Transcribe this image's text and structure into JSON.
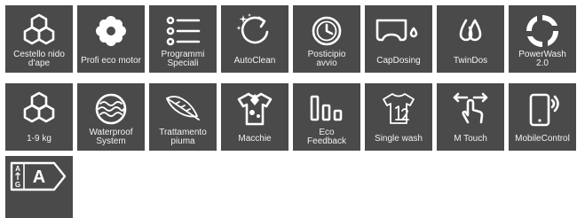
{
  "tiles": [
    {
      "label": "Cestello nido\nd'ape",
      "icon": "honeycomb-drum-icon"
    },
    {
      "label": "Profi eco motor",
      "icon": "flower-gear-icon"
    },
    {
      "label": "Programmi\nSpeciali",
      "icon": "list-icon"
    },
    {
      "label": "AutoClean",
      "icon": "sparkle-refresh-icon"
    },
    {
      "label": "Posticipio\navvio",
      "icon": "clock-icon"
    },
    {
      "label": "CapDosing",
      "icon": "capsule-drop-icon"
    },
    {
      "label": "TwinDos",
      "icon": "twin-drops-icon"
    },
    {
      "label": "PowerWash\n2.0",
      "icon": "spin-arrows-icon"
    },
    {
      "label": "1-9 kg",
      "icon": "honeycomb-icon"
    },
    {
      "label": "Waterproof\nSystem",
      "icon": "waves-circle-icon"
    },
    {
      "label": "Trattamento\npiuma",
      "icon": "feather-icon"
    },
    {
      "label": "Macchie",
      "icon": "stained-shirt-icon"
    },
    {
      "label": "Eco\nFeedback",
      "icon": "bars-icon"
    },
    {
      "label": "Single wash",
      "icon": "single-shirt-icon"
    },
    {
      "label": "M Touch",
      "icon": "touch-hand-icon"
    },
    {
      "label": "MobileControl",
      "icon": "smartphone-wifi-icon"
    },
    {
      "label": "",
      "icon": "energy-label-icon",
      "energy": {
        "top": "A",
        "bottom": "G",
        "class": "A"
      }
    }
  ],
  "colors": {
    "tile": "#4a4a4a",
    "text": "#ffffff"
  }
}
